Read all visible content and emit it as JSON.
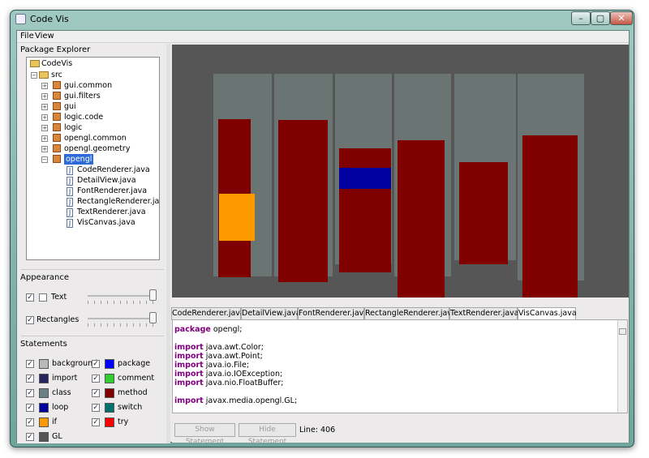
{
  "window": {
    "title": "Code Vis",
    "buttons": [
      "–",
      "▢",
      "✕"
    ]
  },
  "menu": [
    "File",
    "View"
  ],
  "explorer": {
    "title": "Package Explorer",
    "project": "CodeVis",
    "source": "src",
    "packages": [
      "gui.common",
      "gui.filters",
      "gui",
      "logic.code",
      "logic",
      "opengl.common",
      "opengl.geometry",
      "opengl"
    ],
    "files": [
      "CodeRenderer.java",
      "DetailView.java",
      "FontRenderer.java",
      "RectangleRenderer.java",
      "TextRenderer.java",
      "VisCanvas.java"
    ]
  },
  "appearance": {
    "title": "Appearance",
    "text": "Text",
    "rectangles": "Rectangles"
  },
  "statements": {
    "title": "Statements",
    "left": [
      "background",
      "import",
      "class",
      "loop",
      "if",
      "GL"
    ],
    "right": [
      "package",
      "comment",
      "method",
      "switch",
      "try"
    ]
  },
  "colors": {
    "background": "#b9b9b9",
    "import": "#25245f",
    "class": "#6a8285",
    "loop": "#0000a0",
    "if": "#ff9900",
    "GL": "#555555",
    "package": "#0000ff",
    "comment": "#33cc33",
    "method": "#800000",
    "switch": "#00716c",
    "try": "#ff0000"
  },
  "editor": {
    "tabs": [
      "CodeRenderer.java",
      "DetailView.java",
      "FontRenderer.java",
      "RectangleRenderer.java",
      "TextRenderer.java",
      "VisCanvas.java"
    ],
    "lines": [
      "package opengl;",
      "",
      "import java.awt.Color;",
      "import java.awt.Point;",
      "import java.io.File;",
      "import java.io.IOException;",
      "import java.nio.FloatBuffer;",
      "",
      "import javax.media.opengl.GL;"
    ]
  },
  "actions": {
    "show": "Show Statement",
    "hide": "Hide Statement",
    "line": "Line: 406"
  }
}
